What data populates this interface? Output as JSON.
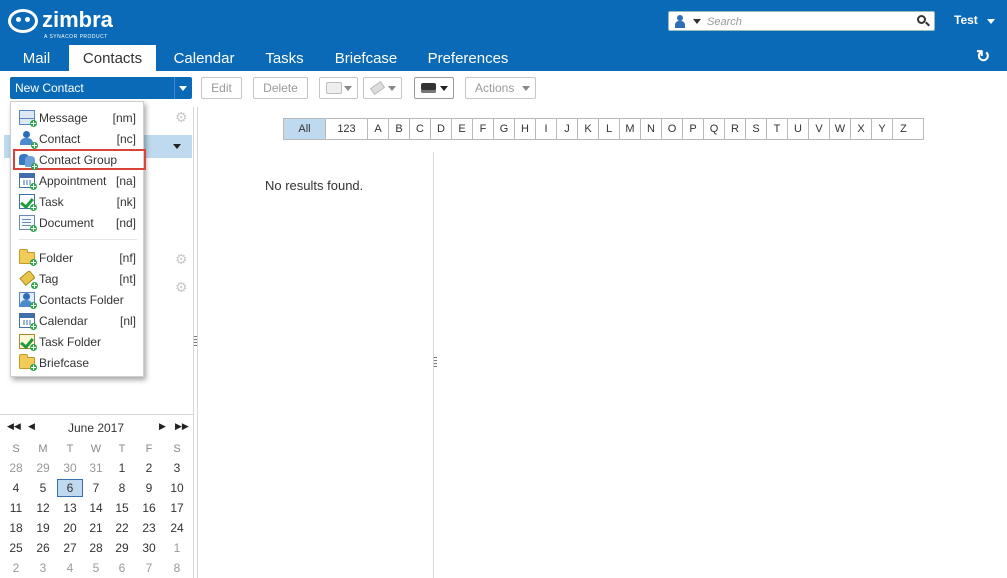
{
  "app": {
    "logo_text": "zimbra",
    "logo_sub": "A SYNACOR PRODUCT"
  },
  "search": {
    "placeholder": "Search"
  },
  "user": {
    "name": "Test"
  },
  "tabs": [
    {
      "label": "Mail"
    },
    {
      "label": "Contacts"
    },
    {
      "label": "Calendar"
    },
    {
      "label": "Tasks"
    },
    {
      "label": "Briefcase"
    },
    {
      "label": "Preferences"
    }
  ],
  "active_tab": "Contacts",
  "toolbar": {
    "new_contact": "New Contact",
    "edit": "Edit",
    "delete": "Delete",
    "actions": "Actions"
  },
  "new_menu": {
    "items": [
      {
        "label": "Message",
        "shortcut": "[nm]",
        "icon": "envelope-icon"
      },
      {
        "label": "Contact",
        "shortcut": "[nc]",
        "icon": "contact-icon"
      },
      {
        "label": "Contact Group",
        "shortcut": "",
        "icon": "contact-group-icon",
        "highlighted": true
      },
      {
        "label": "Appointment",
        "shortcut": "[na]",
        "icon": "calendar-icon"
      },
      {
        "label": "Task",
        "shortcut": "[nk]",
        "icon": "task-icon"
      },
      {
        "label": "Document",
        "shortcut": "[nd]",
        "icon": "document-icon"
      },
      {
        "label": "Folder",
        "shortcut": "[nf]",
        "icon": "folder-icon"
      },
      {
        "label": "Tag",
        "shortcut": "[nt]",
        "icon": "tag-icon"
      },
      {
        "label": "Contacts Folder",
        "shortcut": "",
        "icon": "contacts-folder-icon"
      },
      {
        "label": "Calendar",
        "shortcut": "[nl]",
        "icon": "calendar-folder-icon"
      },
      {
        "label": "Task Folder",
        "shortcut": "",
        "icon": "task-folder-icon"
      },
      {
        "label": "Briefcase",
        "shortcut": "",
        "icon": "briefcase-folder-icon"
      }
    ]
  },
  "alphabet": [
    "All",
    "123",
    "A",
    "B",
    "C",
    "D",
    "E",
    "F",
    "G",
    "H",
    "I",
    "J",
    "K",
    "L",
    "M",
    "N",
    "O",
    "P",
    "Q",
    "R",
    "S",
    "T",
    "U",
    "V",
    "W",
    "X",
    "Y",
    "Z"
  ],
  "alphabet_active": "All",
  "content": {
    "empty_message": "No results found."
  },
  "mini_calendar": {
    "title": "June 2017",
    "weekdays": [
      "S",
      "M",
      "T",
      "W",
      "T",
      "F",
      "S"
    ],
    "weeks": [
      [
        "28",
        "29",
        "30",
        "31",
        "1",
        "2",
        "3"
      ],
      [
        "4",
        "5",
        "6",
        "7",
        "8",
        "9",
        "10"
      ],
      [
        "11",
        "12",
        "13",
        "14",
        "15",
        "16",
        "17"
      ],
      [
        "18",
        "19",
        "20",
        "21",
        "22",
        "23",
        "24"
      ],
      [
        "25",
        "26",
        "27",
        "28",
        "29",
        "30",
        "1"
      ],
      [
        "2",
        "3",
        "4",
        "5",
        "6",
        "7",
        "8"
      ]
    ],
    "today": "6"
  },
  "colors": {
    "header_blue": "#0a6ab7",
    "selection_blue": "#bfd9ef",
    "highlight_red": "#d9443a"
  }
}
